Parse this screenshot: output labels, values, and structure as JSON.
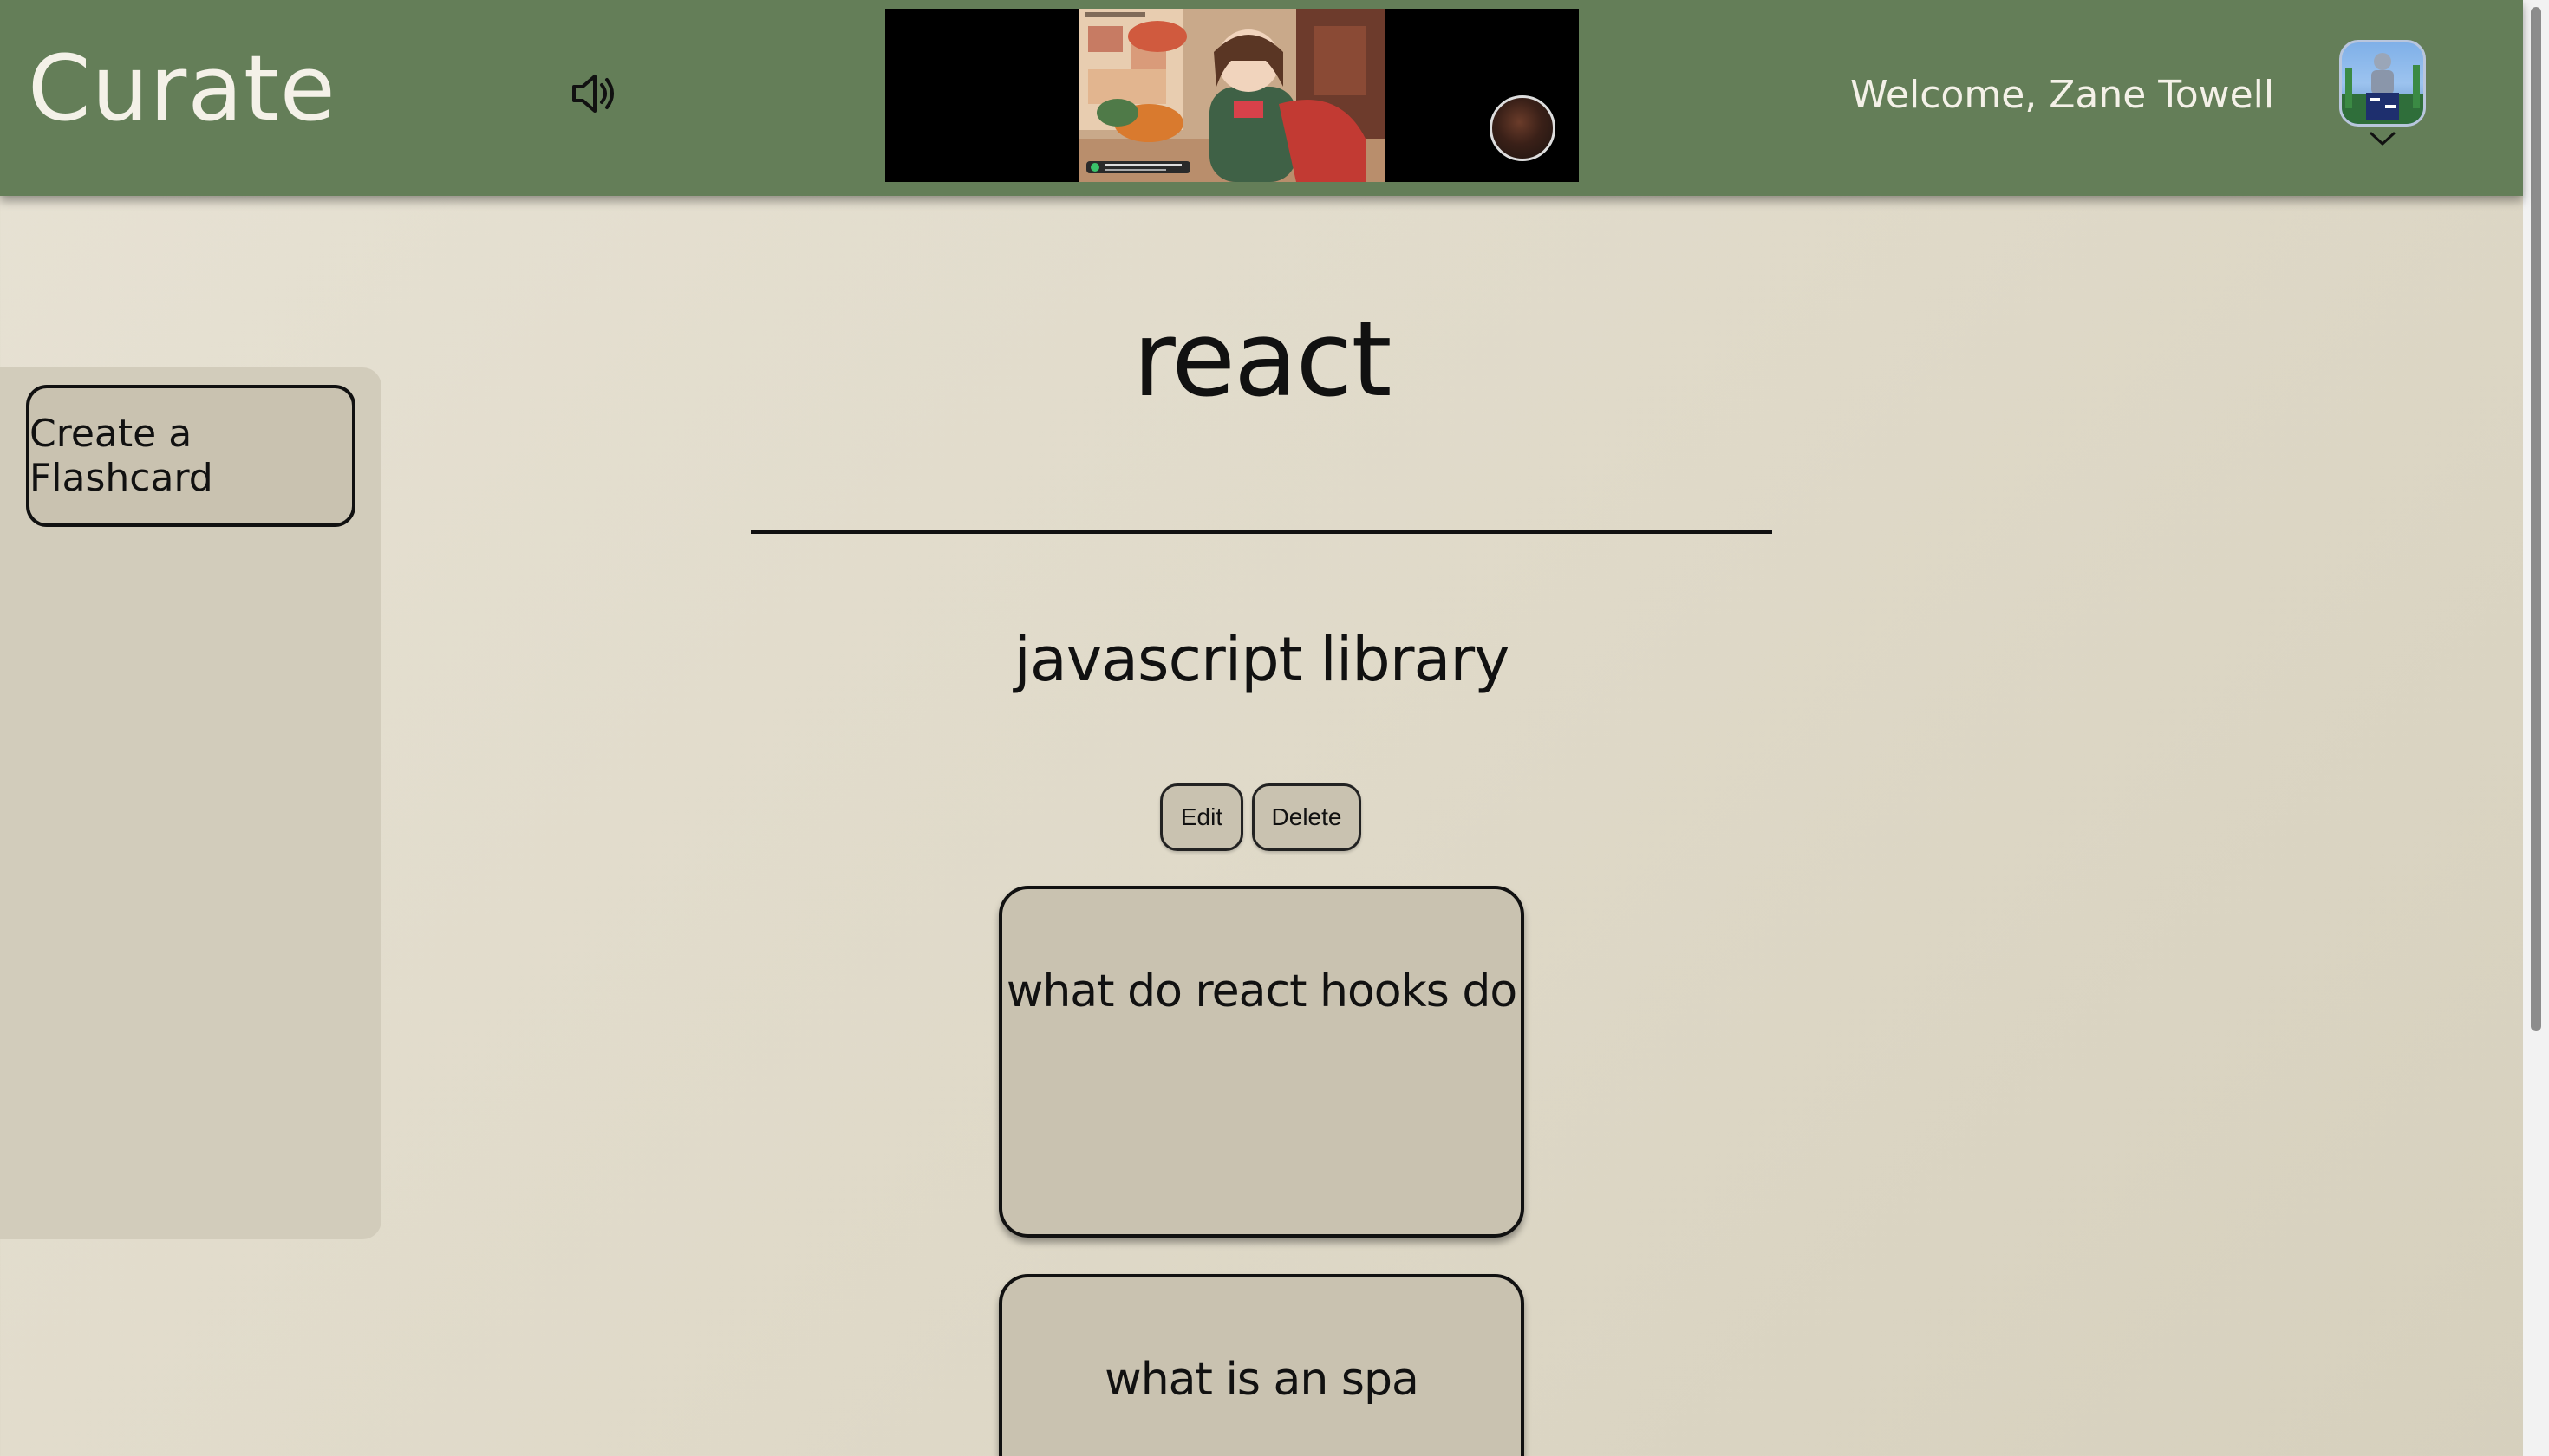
{
  "header": {
    "brand": "Curate",
    "welcome_text": "Welcome, Zane Towell",
    "sound_icon": "speaker-icon",
    "avatar_menu_icon": "chevron-down-icon",
    "background_color": "#647e58"
  },
  "sidebar": {
    "create_button_label": "Create a Flashcard"
  },
  "deck": {
    "title": "react",
    "description": "javascript library",
    "edit_label": "Edit",
    "delete_label": "Delete"
  },
  "flashcards": [
    {
      "question": "what do react hooks do"
    },
    {
      "question": "what is an spa"
    }
  ]
}
